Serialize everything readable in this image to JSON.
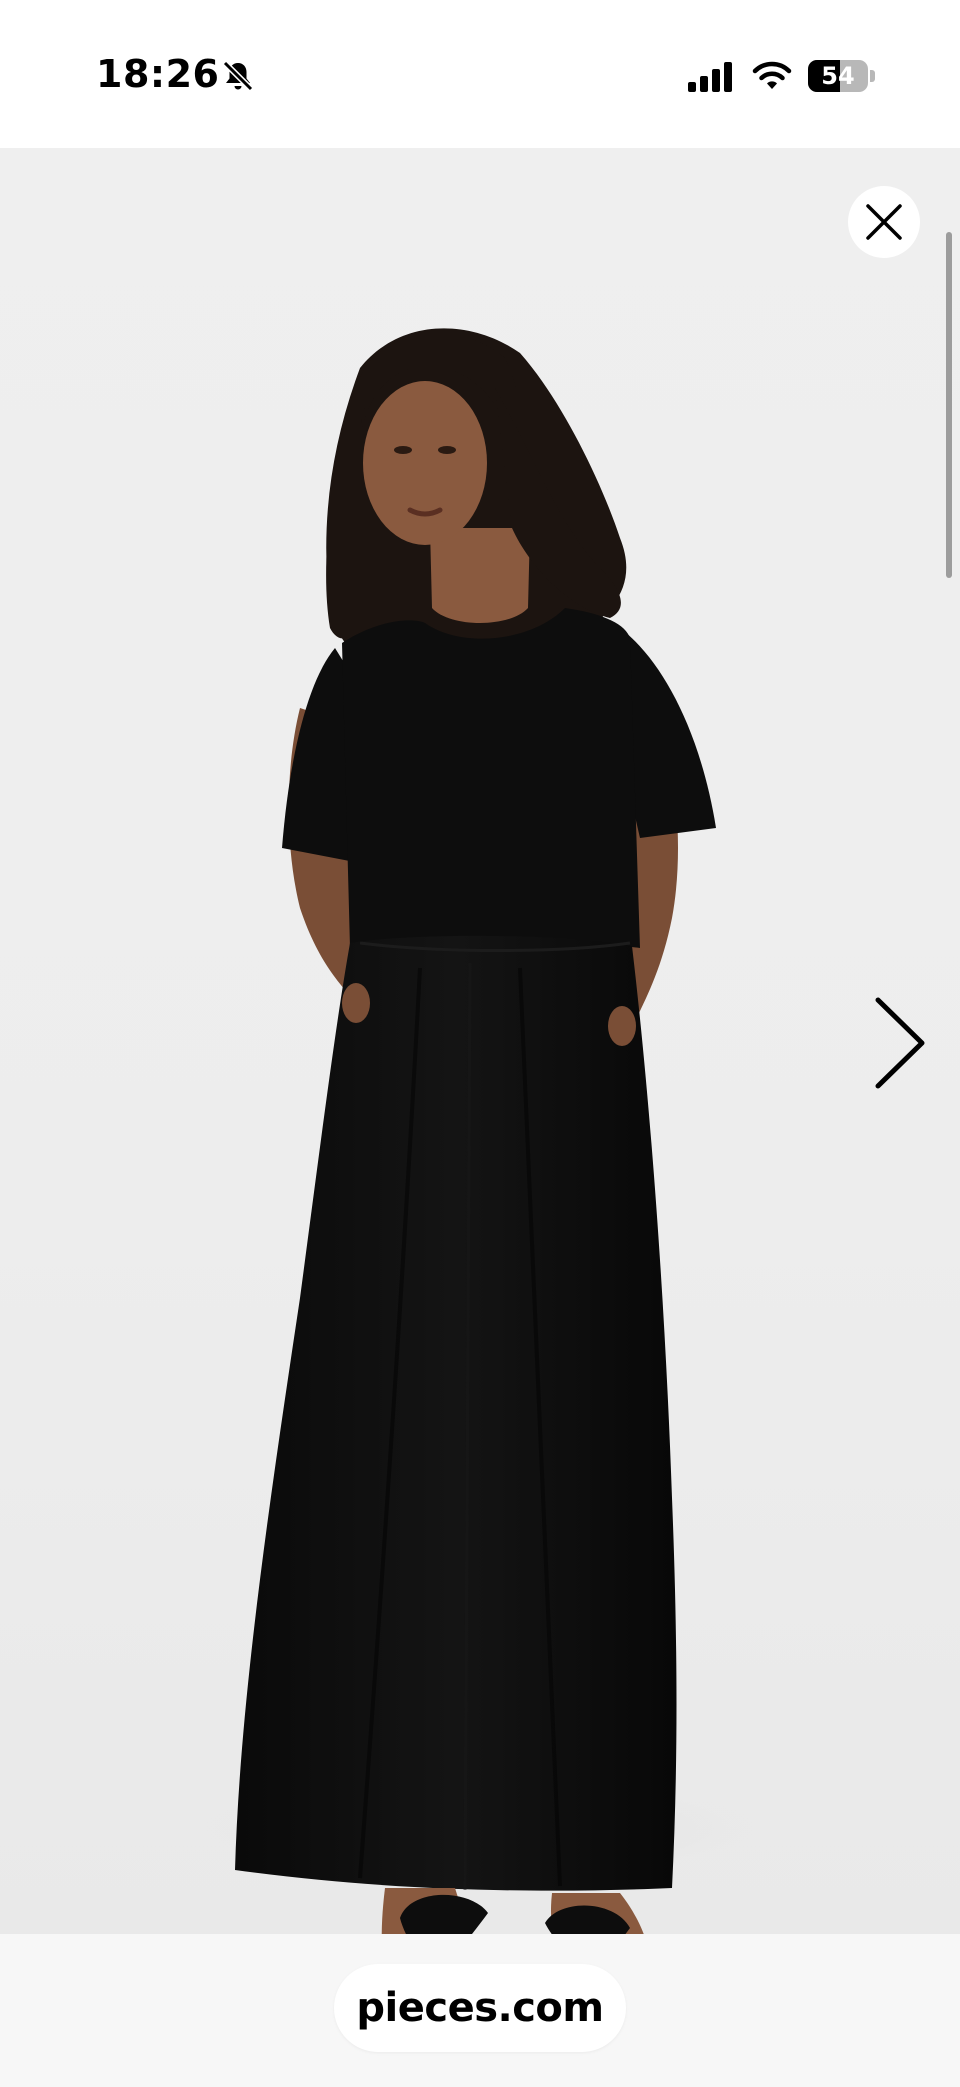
{
  "status_bar": {
    "time": "18:26",
    "battery_percent": 54,
    "battery_level": "54",
    "silent_icon": "bell-slash-icon",
    "signal_icon": "cellular-signal-icon",
    "wifi_icon": "wifi-icon"
  },
  "gallery": {
    "image_icon": "product-photo",
    "close_icon": "close-icon",
    "next_icon": "chevron-right-icon"
  },
  "browser": {
    "url": "pieces.com"
  },
  "colors": {
    "dress": "#0d0d0d",
    "background": "#efefef",
    "skin": "#8a5a3f",
    "hair": "#1c1410"
  }
}
